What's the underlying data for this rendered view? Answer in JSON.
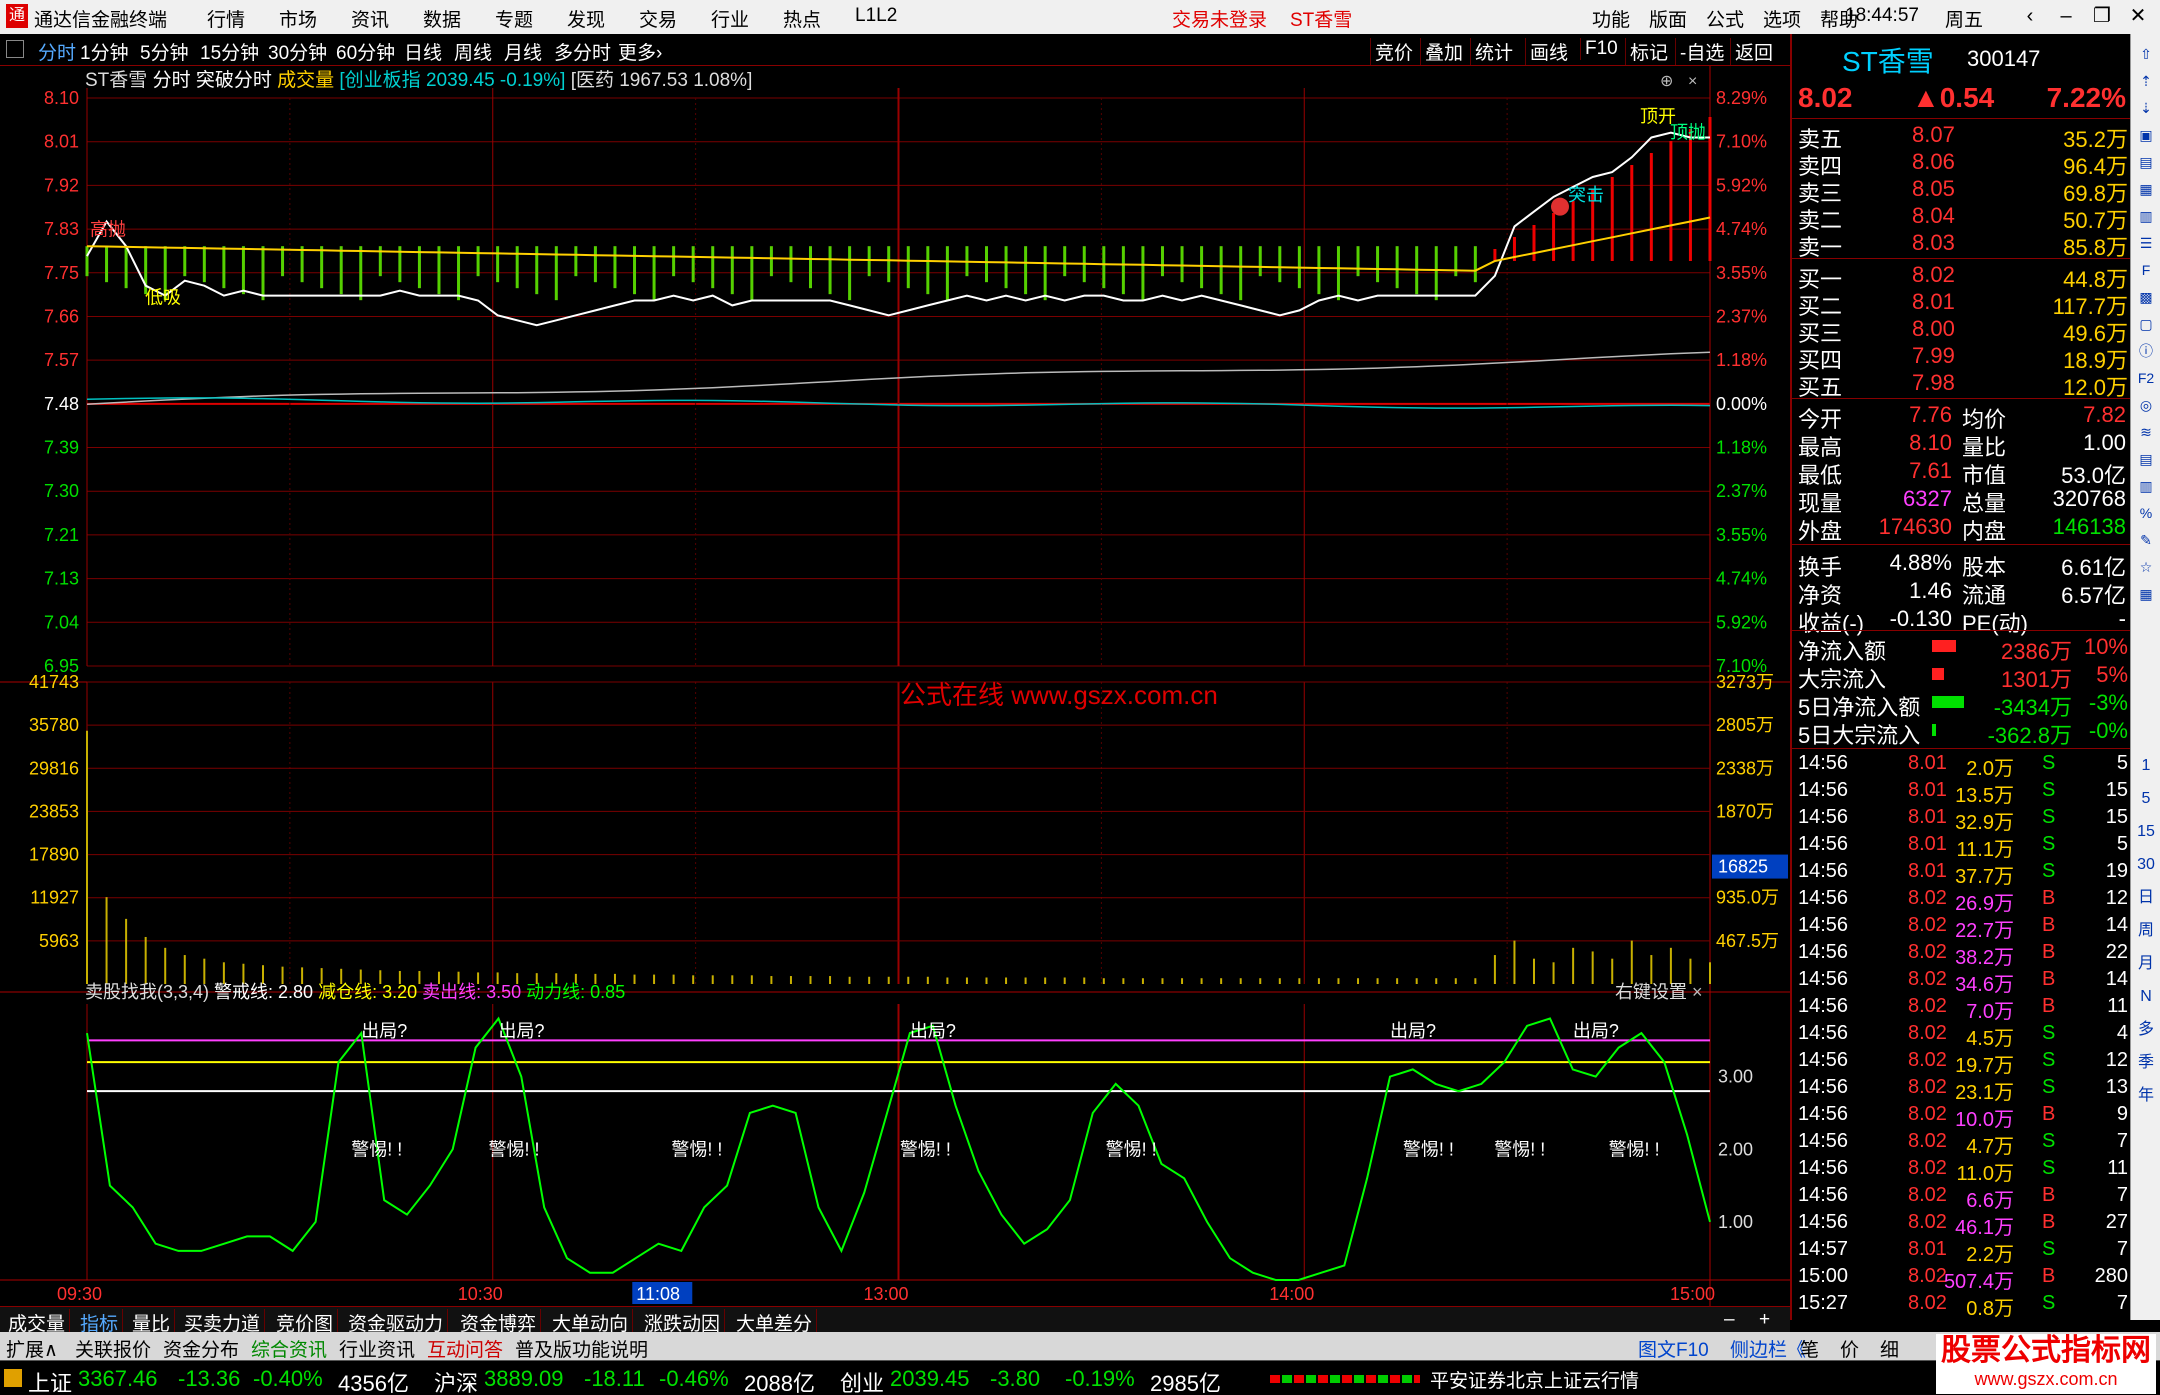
{
  "window": {
    "title": "通达信金融终端",
    "menus": [
      "行情",
      "市场",
      "资讯",
      "数据",
      "专题",
      "发现",
      "交易",
      "行业",
      "热点",
      "L1L2"
    ],
    "login_status": "交易未登录",
    "stock_title": "ST香雪",
    "right_menus": [
      "功能",
      "版面",
      "公式",
      "选项",
      "帮助"
    ],
    "time": "18:44:57",
    "weekday": "周五"
  },
  "toolbar": {
    "periods": [
      "分时",
      "1分钟",
      "5分钟",
      "15分钟",
      "30分钟",
      "60分钟",
      "日线",
      "周线",
      "月线",
      "多分时",
      "更多›"
    ],
    "right": [
      "竞价",
      "叠加",
      "统计",
      "画线",
      "F10",
      "标记",
      "-自选",
      "返回"
    ]
  },
  "chart_header": {
    "name": "ST香雪",
    "mode": "分时",
    "formula": "突破分时",
    "vol": "成交量",
    "index1": "[创业板指 2039.45 -0.19%]",
    "index2": "[医药 1967.53 1.08%]"
  },
  "watermark": "公式在线 www.gszx.com.cn",
  "chart_data": [
    {
      "type": "line",
      "name": "price-chart",
      "y_left_ticks": [
        "8.10",
        "8.01",
        "7.92",
        "7.83",
        "7.75",
        "7.66",
        "7.57",
        "7.48",
        "7.39",
        "7.30",
        "7.21",
        "7.13",
        "7.04",
        "6.95"
      ],
      "y_right_ticks": [
        "8.29%",
        "7.10%",
        "5.92%",
        "4.74%",
        "3.55%",
        "2.37%",
        "1.18%",
        "0.00%",
        "1.18%",
        "2.37%",
        "3.55%",
        "4.74%",
        "5.92%",
        "7.10%"
      ],
      "ylim": [
        6.95,
        8.1
      ],
      "prev_close": 7.48,
      "series": [
        {
          "values": [
            7.78,
            7.85,
            7.8,
            7.72,
            7.7,
            7.73,
            7.72,
            7.7,
            7.71,
            7.7,
            7.7,
            7.7,
            7.7,
            7.7,
            7.7,
            7.7,
            7.71,
            7.7,
            7.7,
            7.7,
            7.69,
            7.66,
            7.65,
            7.64,
            7.65,
            7.66,
            7.67,
            7.68,
            7.69,
            7.69,
            7.7,
            7.69,
            7.7,
            7.68,
            7.69,
            7.69,
            7.69,
            7.69,
            7.69,
            7.68,
            7.67,
            7.66,
            7.67,
            7.68,
            7.69,
            7.7,
            7.69,
            7.7,
            7.69,
            7.7,
            7.69,
            7.7,
            7.7,
            7.69,
            7.69,
            7.7,
            7.69,
            7.7,
            7.69,
            7.68,
            7.67,
            7.66,
            7.67,
            7.69,
            7.7,
            7.69,
            7.7,
            7.7,
            7.7,
            7.7,
            7.7,
            7.7,
            7.74,
            7.84,
            7.87,
            7.9,
            7.92,
            7.94,
            7.95,
            7.98,
            8.02,
            8.03,
            8.02,
            8.02
          ]
        }
      ],
      "annotations": [
        "高抛",
        "低吸",
        "突击",
        "顶开",
        "顶抛"
      ]
    },
    {
      "type": "bar",
      "name": "volume-chart",
      "y_left_ticks": [
        "41743",
        "35780",
        "29816",
        "23853",
        "17890",
        "11927",
        "5963"
      ],
      "y_right_ticks": [
        "3273万",
        "2805万",
        "2338万",
        "1870万",
        "935.0万",
        "467.5万"
      ],
      "current": "16825",
      "ylim": [
        0,
        41743
      ],
      "values": [
        35000,
        12000,
        9000,
        6500,
        5000,
        4000,
        3500,
        3000,
        2800,
        2600,
        2400,
        2300,
        2200,
        2100,
        2000,
        1900,
        1800,
        1800,
        1700,
        1700,
        1600,
        1600,
        1500,
        1500,
        1500,
        1400,
        1400,
        1400,
        1300,
        1300,
        1300,
        1200,
        1200,
        1200,
        1200,
        1100,
        1100,
        1100,
        1100,
        1000,
        1000,
        1000,
        1000,
        1000,
        900,
        900,
        900,
        900,
        900,
        900,
        900,
        900,
        800,
        800,
        800,
        800,
        800,
        800,
        800,
        800,
        800,
        800,
        800,
        800,
        800,
        800,
        800,
        800,
        800,
        800,
        800,
        800,
        4000,
        6000,
        3500,
        3000,
        5000,
        4500,
        3500,
        6000,
        4000,
        5000,
        3500,
        3000
      ]
    },
    {
      "type": "line",
      "name": "indicator-chart",
      "title": "卖股找我(3,3,4)",
      "params": [
        {
          "label": "警戒线: 2.80",
          "color": "#ffffff"
        },
        {
          "label": "减仓线: 3.20",
          "color": "#ffff00"
        },
        {
          "label": "卖出线: 3.50",
          "color": "#ff40ff"
        },
        {
          "label": "动力线: 0.85",
          "color": "#00ff00"
        }
      ],
      "setting": "右键设置",
      "y_right_ticks": [
        "3.00",
        "2.00",
        "1.00"
      ],
      "ylim": [
        0.2,
        4.0
      ],
      "values": [
        3.6,
        1.5,
        1.2,
        0.7,
        0.6,
        0.6,
        0.7,
        0.8,
        0.8,
        0.6,
        1.0,
        3.2,
        3.6,
        1.3,
        1.1,
        1.5,
        2.0,
        3.4,
        3.8,
        3.0,
        1.2,
        0.5,
        0.3,
        0.3,
        0.5,
        0.7,
        0.6,
        1.2,
        1.5,
        2.5,
        2.6,
        2.5,
        1.2,
        0.6,
        1.4,
        2.5,
        3.6,
        3.7,
        2.6,
        1.7,
        1.1,
        0.7,
        0.9,
        1.3,
        2.5,
        2.9,
        2.6,
        1.8,
        1.6,
        1.0,
        0.5,
        0.3,
        0.2,
        0.2,
        0.3,
        0.4,
        1.6,
        3.0,
        3.1,
        2.9,
        2.8,
        2.9,
        3.2,
        3.7,
        3.8,
        3.1,
        3.0,
        3.4,
        3.6,
        3.2,
        2.2,
        1.0
      ],
      "labels": {
        "exit": "出局?",
        "caution": "警惕! !"
      }
    },
    {
      "type": "axis",
      "name": "time-axis",
      "x_labels": [
        "09:30",
        "10:30",
        "11:08",
        "13:00",
        "14:00",
        "15:00"
      ]
    }
  ],
  "quote": {
    "name": "ST香雪",
    "code": "300147",
    "price": "8.02",
    "change": "▲0.54",
    "pct": "7.22%",
    "asks": [
      {
        "label": "卖五",
        "price": "8.07",
        "vol": "35.2万"
      },
      {
        "label": "卖四",
        "price": "8.06",
        "vol": "96.4万"
      },
      {
        "label": "卖三",
        "price": "8.05",
        "vol": "69.8万"
      },
      {
        "label": "卖二",
        "price": "8.04",
        "vol": "50.7万"
      },
      {
        "label": "卖一",
        "price": "8.03",
        "vol": "85.8万"
      }
    ],
    "bids": [
      {
        "label": "买一",
        "price": "8.02",
        "vol": "44.8万"
      },
      {
        "label": "买二",
        "price": "8.01",
        "vol": "117.7万"
      },
      {
        "label": "买三",
        "price": "8.00",
        "vol": "49.6万"
      },
      {
        "label": "买四",
        "price": "7.99",
        "vol": "18.9万"
      },
      {
        "label": "买五",
        "price": "7.98",
        "vol": "12.0万"
      }
    ],
    "stats": [
      {
        "l1": "今开",
        "v1": "7.76",
        "c1": "red",
        "l2": "均价",
        "v2": "7.82",
        "c2": "red"
      },
      {
        "l1": "最高",
        "v1": "8.10",
        "c1": "red",
        "l2": "量比",
        "v2": "1.00",
        "c2": "white"
      },
      {
        "l1": "最低",
        "v1": "7.61",
        "c1": "red",
        "l2": "市值",
        "v2": "53.0亿",
        "c2": "white"
      },
      {
        "l1": "现量",
        "v1": "6327",
        "c1": "magenta",
        "l2": "总量",
        "v2": "320768",
        "c2": "white"
      },
      {
        "l1": "外盘",
        "v1": "174630",
        "c1": "red",
        "l2": "内盘",
        "v2": "146138",
        "c2": "green"
      },
      {
        "l1": "换手",
        "v1": "4.88%",
        "c1": "white",
        "l2": "股本",
        "v2": "6.61亿",
        "c2": "white"
      },
      {
        "l1": "净资",
        "v1": "1.46",
        "c1": "white",
        "l2": "流通",
        "v2": "6.57亿",
        "c2": "white"
      },
      {
        "l1": "收益(-)",
        "v1": "-0.130",
        "c1": "white",
        "l2": "PE(动)",
        "v2": "-",
        "c2": "white"
      }
    ],
    "flows": [
      {
        "label": "净流入额",
        "val": "2386万",
        "pct": "10%",
        "color": "red",
        "bar": 0.3
      },
      {
        "label": "大宗流入",
        "val": "1301万",
        "pct": "5%",
        "color": "red",
        "bar": 0.15
      },
      {
        "label": "5日净流入额",
        "val": "-3434万",
        "pct": "-3%",
        "color": "green",
        "bar": 0.4
      },
      {
        "label": "5日大宗流入",
        "val": "-362.8万",
        "pct": "-0%",
        "color": "green",
        "bar": 0.05
      }
    ],
    "ticks": [
      {
        "t": "14:56",
        "p": "8.01",
        "v": "2.0万",
        "s": "S",
        "n": "5"
      },
      {
        "t": "14:56",
        "p": "8.01",
        "v": "13.5万",
        "s": "S",
        "n": "15"
      },
      {
        "t": "14:56",
        "p": "8.01",
        "v": "32.9万",
        "s": "S",
        "n": "15"
      },
      {
        "t": "14:56",
        "p": "8.01",
        "v": "11.1万",
        "s": "S",
        "n": "5"
      },
      {
        "t": "14:56",
        "p": "8.01",
        "v": "37.7万",
        "s": "S",
        "n": "19"
      },
      {
        "t": "14:56",
        "p": "8.02",
        "v": "26.9万",
        "s": "B",
        "n": "12"
      },
      {
        "t": "14:56",
        "p": "8.02",
        "v": "22.7万",
        "s": "B",
        "n": "14"
      },
      {
        "t": "14:56",
        "p": "8.02",
        "v": "38.2万",
        "s": "B",
        "n": "22"
      },
      {
        "t": "14:56",
        "p": "8.02",
        "v": "34.6万",
        "s": "B",
        "n": "14"
      },
      {
        "t": "14:56",
        "p": "8.02",
        "v": "7.0万",
        "s": "B",
        "n": "11"
      },
      {
        "t": "14:56",
        "p": "8.02",
        "v": "4.5万",
        "s": "S",
        "n": "4"
      },
      {
        "t": "14:56",
        "p": "8.02",
        "v": "19.7万",
        "s": "S",
        "n": "12"
      },
      {
        "t": "14:56",
        "p": "8.02",
        "v": "23.1万",
        "s": "S",
        "n": "13"
      },
      {
        "t": "14:56",
        "p": "8.02",
        "v": "10.0万",
        "s": "B",
        "n": "9"
      },
      {
        "t": "14:56",
        "p": "8.02",
        "v": "4.7万",
        "s": "S",
        "n": "7"
      },
      {
        "t": "14:56",
        "p": "8.02",
        "v": "11.0万",
        "s": "S",
        "n": "11"
      },
      {
        "t": "14:56",
        "p": "8.02",
        "v": "6.6万",
        "s": "B",
        "n": "7"
      },
      {
        "t": "14:56",
        "p": "8.02",
        "v": "46.1万",
        "s": "B",
        "n": "27"
      },
      {
        "t": "14:57",
        "p": "8.01",
        "v": "2.2万",
        "s": "S",
        "n": "7"
      },
      {
        "t": "15:00",
        "p": "8.02",
        "v": "507.4万",
        "s": "B",
        "n": "280"
      },
      {
        "t": "15:27",
        "p": "8.02",
        "v": "0.8万",
        "s": "S",
        "n": "7"
      }
    ]
  },
  "side_icons": [
    "1",
    "5",
    "15",
    "30",
    "日",
    "周",
    "月",
    "N",
    "多",
    "季",
    "年"
  ],
  "tabs1": [
    "成交量",
    "指标",
    "量比",
    "买卖力道",
    "竞价图",
    "资金驱动力",
    "资金博弈",
    "大单动向",
    "涨跌动因",
    "大单差分"
  ],
  "tabs2": [
    "扩展∧",
    "关联报价",
    "资金分布",
    "综合资讯",
    "行业资讯",
    "互动问答",
    "普及版功能说明"
  ],
  "tabs2_right": [
    "图文F10",
    "侧边栏《",
    "笔",
    "价",
    "细"
  ],
  "status": [
    {
      "name": "上证",
      "idx": "3367.46",
      "chg": "-13.36",
      "pct": "-0.40%",
      "amt": "4356亿"
    },
    {
      "name": "沪深",
      "idx": "3889.09",
      "chg": "-18.11",
      "pct": "-0.46%",
      "amt": "2088亿"
    },
    {
      "name": "创业",
      "idx": "2039.45",
      "chg": "-3.80",
      "pct": "-0.19%",
      "amt": "2985亿"
    }
  ],
  "status_right": "平安证券北京上证云行情",
  "logo": {
    "line1": "股票公式指标网",
    "line2": "www.gszx.com.cn"
  }
}
